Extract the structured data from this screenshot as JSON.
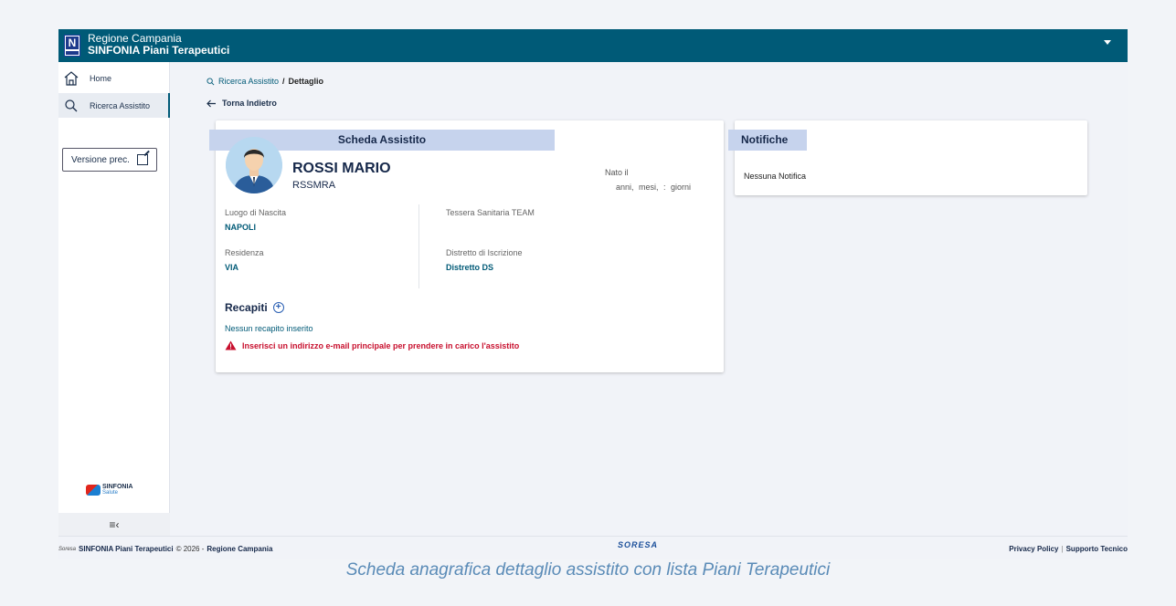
{
  "header": {
    "org_name": "Regione Campania",
    "app_name": "SINFONIA Piani Terapeutici",
    "logo_letter": "N"
  },
  "sidebar": {
    "items": [
      {
        "label": "Home",
        "icon": "home-icon"
      },
      {
        "label": "Ricerca Assistito",
        "icon": "search-icon",
        "active": true
      }
    ],
    "version_button": "Versione prec.",
    "brand_logo": "SINFONIA",
    "brand_sub": "Salute",
    "collapse_glyph": "≡‹"
  },
  "breadcrumb": {
    "link": "Ricerca Assistito",
    "separator": "/",
    "current": "Dettaglio"
  },
  "back_link": "Torna Indietro",
  "scheda": {
    "title": "Scheda Assistito",
    "name": "ROSSI MARIO",
    "codice_fiscale": "RSSMRA",
    "nato_label": "Nato il",
    "eta_text": "anni, mesi, : giorni",
    "luogo_nascita_label": "Luogo di Nascita",
    "luogo_nascita_value": "NAPOLI",
    "tessera_label": "Tessera Sanitaria TEAM",
    "residenza_label": "Residenza",
    "residenza_value": "VIA",
    "distretto_label": "Distretto di Iscrizione",
    "distretto_value": "Distretto DS",
    "recapiti_title": "Recapiti",
    "no_recapiti": "Nessun recapito inserito",
    "warning": "Inserisci un indirizzo e-mail principale per prendere in carico l'assistito"
  },
  "notifiche": {
    "title": "Notifiche",
    "empty": "Nessuna Notifica"
  },
  "footer": {
    "left_mini": "Soresa",
    "left_app": "SINFONIA Piani Terapeutici",
    "left_copy": "© 2026 -",
    "left_org": "Regione Campania",
    "center_logo": "SORESA",
    "privacy": "Privacy Policy",
    "separator": "|",
    "support": "Supporto Tecnico"
  },
  "caption": "Scheda anagrafica dettaglio assistito con lista Piani Terapeutici",
  "colors": {
    "header_bg": "#005a77",
    "card_header_bg": "#c6d3ed",
    "link": "#005a77",
    "warning": "#c8102e"
  }
}
